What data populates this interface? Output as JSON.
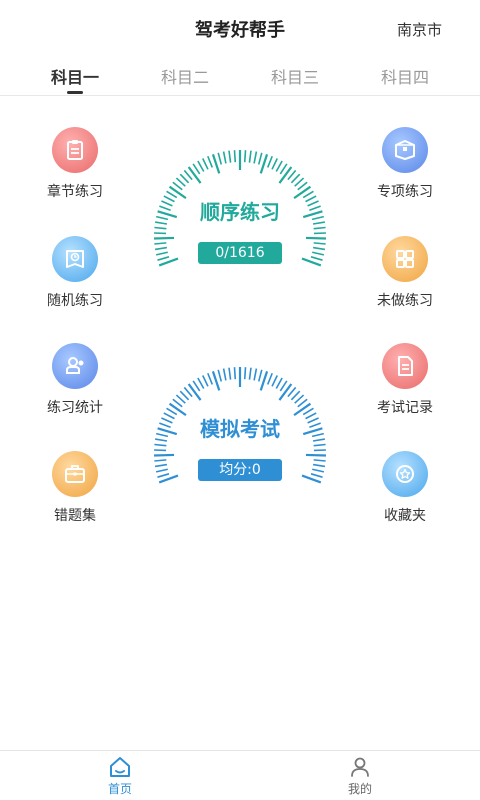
{
  "header": {
    "title": "驾考好帮手",
    "city": "南京市"
  },
  "tabs": [
    {
      "label": "科目一",
      "active": true
    },
    {
      "label": "科目二",
      "active": false
    },
    {
      "label": "科目三",
      "active": false
    },
    {
      "label": "科目四",
      "active": false
    }
  ],
  "features": {
    "chapter_practice": {
      "label": "章节练习",
      "icon": "clipboard-icon",
      "color": "#e96a6a"
    },
    "special_practice": {
      "label": "专项练习",
      "icon": "box-icon",
      "color": "#5a86e8"
    },
    "random_practice": {
      "label": "随机练习",
      "icon": "clock-book-icon",
      "color": "#4aa6ec"
    },
    "undone_practice": {
      "label": "未做练习",
      "icon": "grid-icon",
      "color": "#f0a440"
    },
    "practice_stats": {
      "label": "练习统计",
      "icon": "stamp-icon",
      "color": "#5a86e8"
    },
    "exam_records": {
      "label": "考试记录",
      "icon": "document-icon",
      "color": "#e96a6a"
    },
    "wrong_questions": {
      "label": "错题集",
      "icon": "briefcase-icon",
      "color": "#f0a440"
    },
    "favorites": {
      "label": "收藏夹",
      "icon": "star-icon",
      "color": "#4aa6ec"
    }
  },
  "sequential": {
    "title": "顺序练习",
    "progress": "0/1616",
    "color": "#21a99c"
  },
  "mock_exam": {
    "title": "模拟考试",
    "average": "均分:0",
    "color": "#2f8fd4"
  },
  "bottom_nav": {
    "home": {
      "label": "首页",
      "active": true
    },
    "mine": {
      "label": "我的",
      "active": false
    }
  }
}
